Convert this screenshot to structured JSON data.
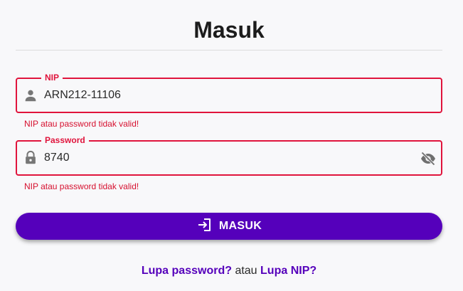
{
  "page": {
    "title": "Masuk"
  },
  "form": {
    "nip": {
      "label": "NIP",
      "value": "ARN212-11106",
      "icon": "person-icon",
      "error": "NIP atau password tidak valid!"
    },
    "password": {
      "label": "Password",
      "value": "8740",
      "icon": "lock-icon",
      "toggle_icon": "eye-off-icon",
      "error": "NIP atau password tidak valid!"
    },
    "submit_label": "MASUK",
    "submit_icon": "login-icon"
  },
  "links": {
    "forgot_password": "Lupa password?",
    "separator": "atau",
    "forgot_nip": "Lupa NIP?"
  },
  "colors": {
    "primary": "#5500bb",
    "error": "#e0143c",
    "background": "#f8f8fa"
  }
}
